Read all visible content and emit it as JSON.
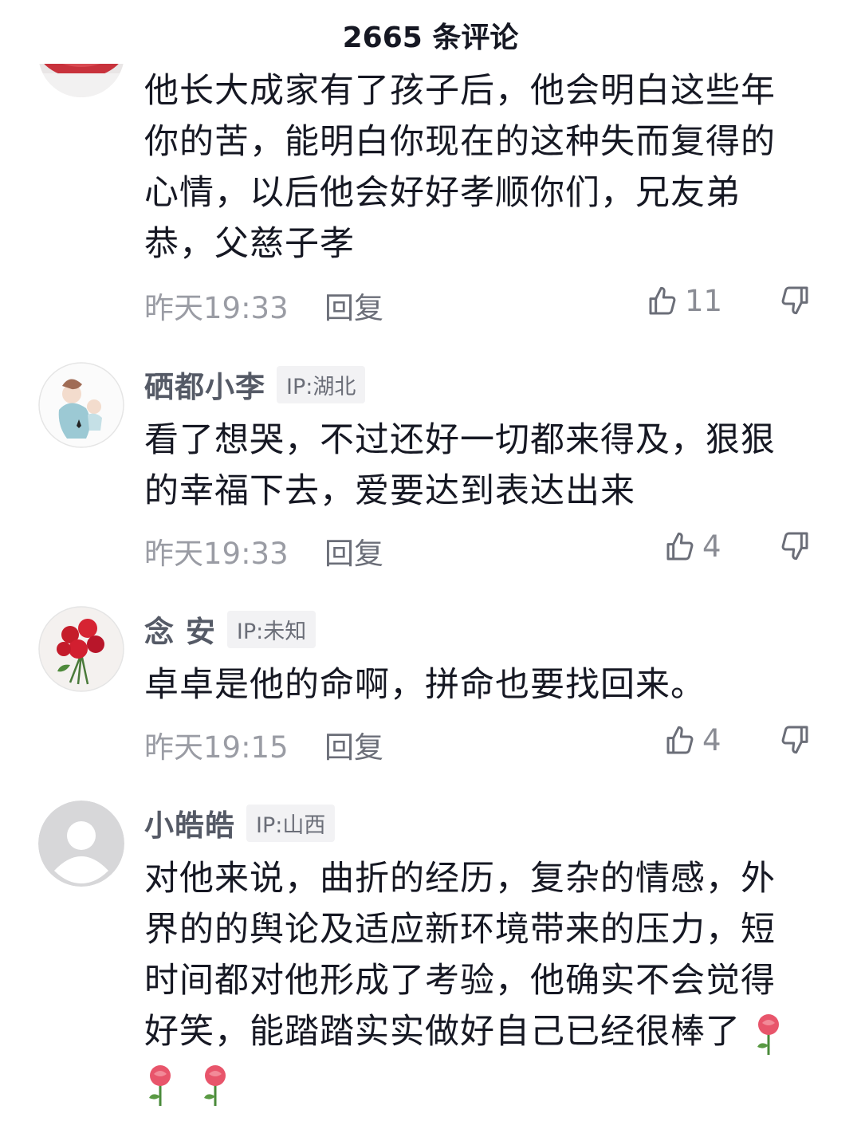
{
  "header": {
    "title": "2665 条评论"
  },
  "comments": [
    {
      "text": "他长大成家有了孩子后，他会明白这些年你的苦，能明白你现在的这种失而复得的心情，以后他会好好孝顺你们，兄友弟恭，父慈子孝",
      "lines": [
        "他长大成家有了孩子后，他会明白这些年",
        "你的苦，能明白你现在的这种失而复得的",
        "心情，以后他会好好孝顺你们，兄友弟",
        "恭，父慈子孝"
      ],
      "time": "昨天19:33",
      "reply": "回复",
      "likes": "11"
    },
    {
      "username": "硒都小李",
      "ip": "IP:湖北",
      "lines": [
        "看了想哭，不过还好一切都来得及，狠狠",
        "的幸福下去，爱要达到表达出来"
      ],
      "time": "昨天19:33",
      "reply": "回复",
      "likes": "4"
    },
    {
      "username": "念 安",
      "ip": "IP:未知",
      "lines": [
        "卓卓是他的命啊，拼命也要找回来。"
      ],
      "time": "昨天19:15",
      "reply": "回复",
      "likes": "4"
    },
    {
      "username": "小皓皓",
      "ip": "IP:山西",
      "lines": [
        "对他来说，曲折的经历，复杂的情感，外",
        "界的的舆论及适应新环境带来的压力，短",
        "时间都对他形成了考验，他确实不会觉得",
        "好笑，能踏踏实实做好自己已经很棒了"
      ],
      "emoji": "rose-emoji"
    }
  ],
  "icons": {
    "like": "thumbs-up-icon",
    "dislike": "thumbs-down-icon"
  },
  "colors": {
    "text": "#161823",
    "secondary": "#9a9ca4",
    "rose": "#e8556b"
  }
}
